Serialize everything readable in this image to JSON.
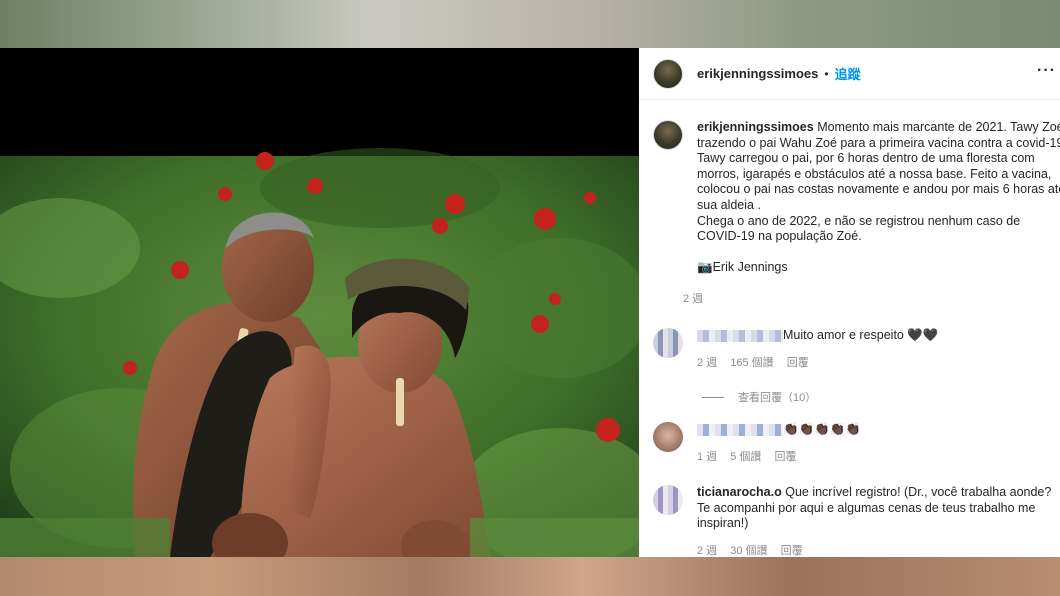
{
  "post": {
    "username": "erikjenningssimoes",
    "separator": "•",
    "follow_label": "追蹤",
    "more_label": "···",
    "caption_username": "erikjenningssimoes",
    "caption_text": " Momento mais marcante de 2021. Tawy Zoé trazendo o pai Wahu Zoé para a primeira vacina contra a covid-19.\nTawy carregou o pai, por 6 horas dentro de uma floresta com morros, igarapés e obstáculos até a nossa base. Feito a vacina, colocou o pai nas costas novamente e andou por mais 6 horas até sua aldeia .\nChega o ano de 2022, e não se registrou nenhum caso de COVID-19 na população Zoé.\n\n📷Erik Jennings",
    "caption_age": "2 週"
  },
  "comments": [
    {
      "text": "Muito amor e respeito 🖤🖤",
      "age": "2 週",
      "likes": "165 個讚",
      "reply_label": "回覆",
      "view_replies": "查看回覆（10）"
    },
    {
      "text": "👏🏿👏🏿👏🏿👏🏿👏🏿",
      "age": "1 週",
      "likes": "5 個讚",
      "reply_label": "回覆"
    },
    {
      "username": "ticianarocha.o",
      "text": " Que incrível registro! (Dr., você trabalha aonde? Te acompanhi por aqui e algumas cenas de teus trabalho me inspiran!)",
      "age": "2 週",
      "likes": "30 個讚",
      "reply_label": "回覆"
    }
  ]
}
